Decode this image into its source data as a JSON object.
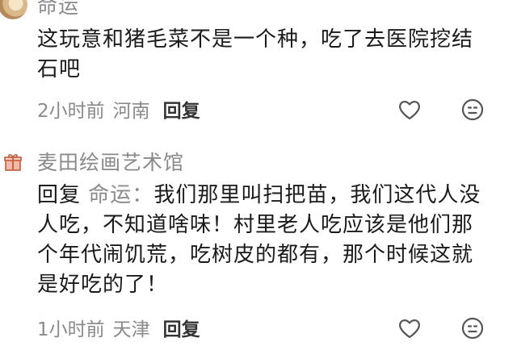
{
  "comments": [
    {
      "username": "命运",
      "text": "这玩意和猪毛菜不是一个种，吃了去医院挖结石吧",
      "time": "2小时前",
      "location": "河南",
      "reply_label": "回复",
      "like_icon": "heart-outline-icon",
      "emoji_icon": "smiley-face-icon"
    },
    {
      "username": "麦田绘画艺术馆",
      "reply_prefix": "回复",
      "reply_to": "命运",
      "reply_colon": "：",
      "text": "我们那里叫扫把苗，我们这代人没人吃，不知道啥味！村里老人吃应该是他们那个年代闹饥荒，吃树皮的都有，那个时候这就是好吃的了！",
      "time": "1小时前",
      "location": "天津",
      "reply_label": "回复",
      "avatar_icon": "gift-box-icon",
      "like_icon": "heart-outline-icon",
      "emoji_icon": "smiley-face-icon"
    }
  ],
  "colors": {
    "text": "#1a1a1a",
    "meta": "#8a8a8a",
    "icon": "#666666"
  }
}
